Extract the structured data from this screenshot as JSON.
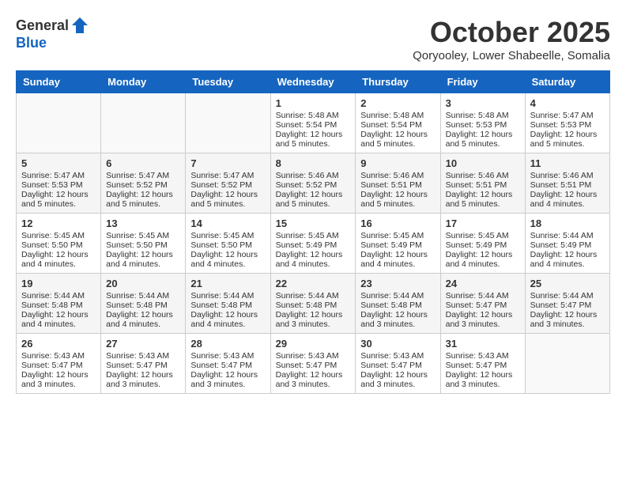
{
  "header": {
    "logo_general": "General",
    "logo_blue": "Blue",
    "month": "October 2025",
    "location": "Qoryooley, Lower Shabeelle, Somalia"
  },
  "weekdays": [
    "Sunday",
    "Monday",
    "Tuesday",
    "Wednesday",
    "Thursday",
    "Friday",
    "Saturday"
  ],
  "weeks": [
    [
      {
        "day": "",
        "info": ""
      },
      {
        "day": "",
        "info": ""
      },
      {
        "day": "",
        "info": ""
      },
      {
        "day": "1",
        "sunrise": "Sunrise: 5:48 AM",
        "sunset": "Sunset: 5:54 PM",
        "daylight": "Daylight: 12 hours and 5 minutes."
      },
      {
        "day": "2",
        "sunrise": "Sunrise: 5:48 AM",
        "sunset": "Sunset: 5:54 PM",
        "daylight": "Daylight: 12 hours and 5 minutes."
      },
      {
        "day": "3",
        "sunrise": "Sunrise: 5:48 AM",
        "sunset": "Sunset: 5:53 PM",
        "daylight": "Daylight: 12 hours and 5 minutes."
      },
      {
        "day": "4",
        "sunrise": "Sunrise: 5:47 AM",
        "sunset": "Sunset: 5:53 PM",
        "daylight": "Daylight: 12 hours and 5 minutes."
      }
    ],
    [
      {
        "day": "5",
        "sunrise": "Sunrise: 5:47 AM",
        "sunset": "Sunset: 5:53 PM",
        "daylight": "Daylight: 12 hours and 5 minutes."
      },
      {
        "day": "6",
        "sunrise": "Sunrise: 5:47 AM",
        "sunset": "Sunset: 5:52 PM",
        "daylight": "Daylight: 12 hours and 5 minutes."
      },
      {
        "day": "7",
        "sunrise": "Sunrise: 5:47 AM",
        "sunset": "Sunset: 5:52 PM",
        "daylight": "Daylight: 12 hours and 5 minutes."
      },
      {
        "day": "8",
        "sunrise": "Sunrise: 5:46 AM",
        "sunset": "Sunset: 5:52 PM",
        "daylight": "Daylight: 12 hours and 5 minutes."
      },
      {
        "day": "9",
        "sunrise": "Sunrise: 5:46 AM",
        "sunset": "Sunset: 5:51 PM",
        "daylight": "Daylight: 12 hours and 5 minutes."
      },
      {
        "day": "10",
        "sunrise": "Sunrise: 5:46 AM",
        "sunset": "Sunset: 5:51 PM",
        "daylight": "Daylight: 12 hours and 5 minutes."
      },
      {
        "day": "11",
        "sunrise": "Sunrise: 5:46 AM",
        "sunset": "Sunset: 5:51 PM",
        "daylight": "Daylight: 12 hours and 4 minutes."
      }
    ],
    [
      {
        "day": "12",
        "sunrise": "Sunrise: 5:45 AM",
        "sunset": "Sunset: 5:50 PM",
        "daylight": "Daylight: 12 hours and 4 minutes."
      },
      {
        "day": "13",
        "sunrise": "Sunrise: 5:45 AM",
        "sunset": "Sunset: 5:50 PM",
        "daylight": "Daylight: 12 hours and 4 minutes."
      },
      {
        "day": "14",
        "sunrise": "Sunrise: 5:45 AM",
        "sunset": "Sunset: 5:50 PM",
        "daylight": "Daylight: 12 hours and 4 minutes."
      },
      {
        "day": "15",
        "sunrise": "Sunrise: 5:45 AM",
        "sunset": "Sunset: 5:49 PM",
        "daylight": "Daylight: 12 hours and 4 minutes."
      },
      {
        "day": "16",
        "sunrise": "Sunrise: 5:45 AM",
        "sunset": "Sunset: 5:49 PM",
        "daylight": "Daylight: 12 hours and 4 minutes."
      },
      {
        "day": "17",
        "sunrise": "Sunrise: 5:45 AM",
        "sunset": "Sunset: 5:49 PM",
        "daylight": "Daylight: 12 hours and 4 minutes."
      },
      {
        "day": "18",
        "sunrise": "Sunrise: 5:44 AM",
        "sunset": "Sunset: 5:49 PM",
        "daylight": "Daylight: 12 hours and 4 minutes."
      }
    ],
    [
      {
        "day": "19",
        "sunrise": "Sunrise: 5:44 AM",
        "sunset": "Sunset: 5:48 PM",
        "daylight": "Daylight: 12 hours and 4 minutes."
      },
      {
        "day": "20",
        "sunrise": "Sunrise: 5:44 AM",
        "sunset": "Sunset: 5:48 PM",
        "daylight": "Daylight: 12 hours and 4 minutes."
      },
      {
        "day": "21",
        "sunrise": "Sunrise: 5:44 AM",
        "sunset": "Sunset: 5:48 PM",
        "daylight": "Daylight: 12 hours and 4 minutes."
      },
      {
        "day": "22",
        "sunrise": "Sunrise: 5:44 AM",
        "sunset": "Sunset: 5:48 PM",
        "daylight": "Daylight: 12 hours and 3 minutes."
      },
      {
        "day": "23",
        "sunrise": "Sunrise: 5:44 AM",
        "sunset": "Sunset: 5:48 PM",
        "daylight": "Daylight: 12 hours and 3 minutes."
      },
      {
        "day": "24",
        "sunrise": "Sunrise: 5:44 AM",
        "sunset": "Sunset: 5:47 PM",
        "daylight": "Daylight: 12 hours and 3 minutes."
      },
      {
        "day": "25",
        "sunrise": "Sunrise: 5:44 AM",
        "sunset": "Sunset: 5:47 PM",
        "daylight": "Daylight: 12 hours and 3 minutes."
      }
    ],
    [
      {
        "day": "26",
        "sunrise": "Sunrise: 5:43 AM",
        "sunset": "Sunset: 5:47 PM",
        "daylight": "Daylight: 12 hours and 3 minutes."
      },
      {
        "day": "27",
        "sunrise": "Sunrise: 5:43 AM",
        "sunset": "Sunset: 5:47 PM",
        "daylight": "Daylight: 12 hours and 3 minutes."
      },
      {
        "day": "28",
        "sunrise": "Sunrise: 5:43 AM",
        "sunset": "Sunset: 5:47 PM",
        "daylight": "Daylight: 12 hours and 3 minutes."
      },
      {
        "day": "29",
        "sunrise": "Sunrise: 5:43 AM",
        "sunset": "Sunset: 5:47 PM",
        "daylight": "Daylight: 12 hours and 3 minutes."
      },
      {
        "day": "30",
        "sunrise": "Sunrise: 5:43 AM",
        "sunset": "Sunset: 5:47 PM",
        "daylight": "Daylight: 12 hours and 3 minutes."
      },
      {
        "day": "31",
        "sunrise": "Sunrise: 5:43 AM",
        "sunset": "Sunset: 5:47 PM",
        "daylight": "Daylight: 12 hours and 3 minutes."
      },
      {
        "day": "",
        "info": ""
      }
    ]
  ]
}
